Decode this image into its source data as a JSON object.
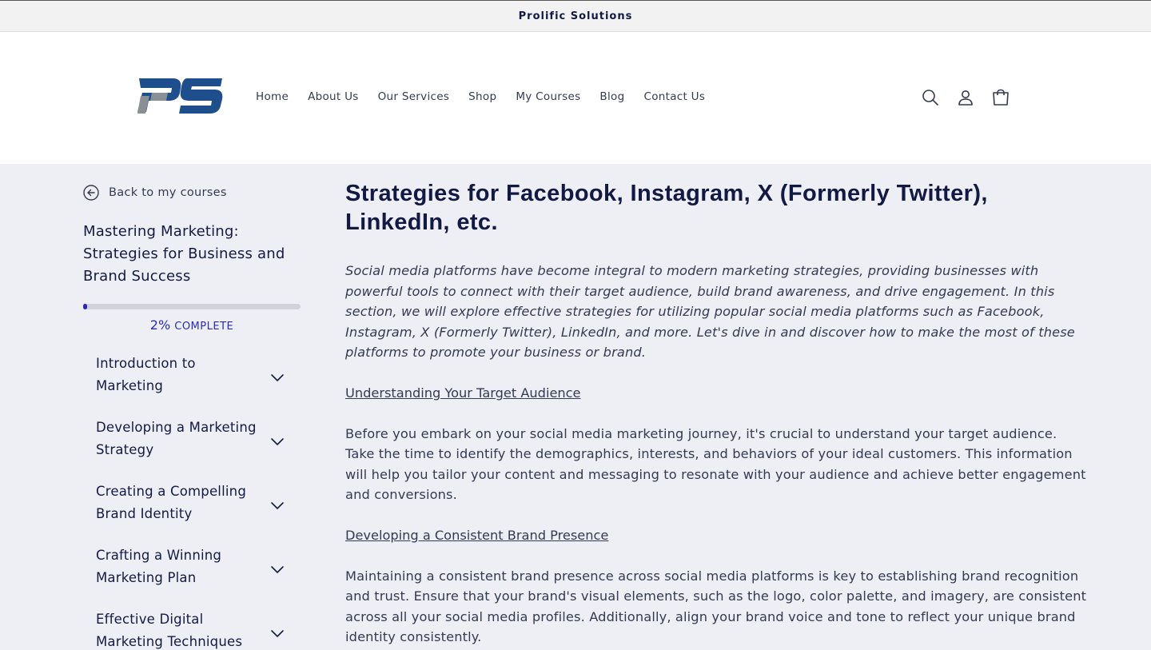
{
  "announcement": {
    "text": "Prolific Solutions"
  },
  "header": {
    "logo_alt": "PS",
    "nav": [
      {
        "label": "Home"
      },
      {
        "label": "About Us"
      },
      {
        "label": "Our Services"
      },
      {
        "label": "Shop"
      },
      {
        "label": "My Courses"
      },
      {
        "label": "Blog"
      },
      {
        "label": "Contact Us"
      }
    ],
    "icons": [
      "search-icon",
      "account-icon",
      "cart-icon"
    ]
  },
  "sidebar": {
    "back_label": "Back to my courses",
    "course_title": "Mastering Marketing: Strategies for Business and Brand Success",
    "progress": {
      "percent": 2,
      "percent_label": "2%",
      "complete_label": "COMPLETE"
    },
    "modules": [
      {
        "label": "Introduction to Marketing"
      },
      {
        "label": "Developing a Marketing Strategy"
      },
      {
        "label": "Creating a Compelling Brand Identity"
      },
      {
        "label": "Crafting a Winning Marketing Plan"
      },
      {
        "label": "Effective Digital Marketing Techniques"
      }
    ]
  },
  "lesson": {
    "title": "Strategies for Facebook, Instagram, X (Formerly Twitter), LinkedIn, etc.",
    "intro": "Social media platforms have become integral to modern marketing strategies, providing businesses with powerful tools to connect with their target audience, build brand awareness, and drive engagement. In this section, we will explore effective strategies for utilizing popular social media platforms such as Facebook, Instagram, X (Formerly Twitter), LinkedIn, and more. Let's dive in and discover how to make the most of these platforms to promote your business or brand.",
    "sections": [
      {
        "heading": "Understanding Your Target Audience",
        "body": "Before you embark on your social media marketing journey, it's crucial to understand your target audience. Take the time to identify the demographics, interests, and behaviors of your ideal customers. This information will help you tailor your content and messaging to resonate with your audience and achieve better engagement and conversions."
      },
      {
        "heading": "Developing a Consistent Brand Presence",
        "body": "Maintaining a consistent brand presence across social media platforms is key to establishing brand recognition and trust. Ensure that your brand's visual elements, such as the logo, color palette, and imagery, are consistent across all your social media profiles. Additionally, align your brand voice and tone to reflect your unique brand identity consistently."
      }
    ]
  },
  "colors": {
    "page_bg": "#eeeff5",
    "header_bg": "#ffffff",
    "heading": "#121a44",
    "text": "#333a52",
    "progress_fill": "#2a2ab8",
    "progress_track": "#d0d3dc",
    "logo_blue": "#1f4e8c",
    "logo_gray": "#8a8f95"
  }
}
